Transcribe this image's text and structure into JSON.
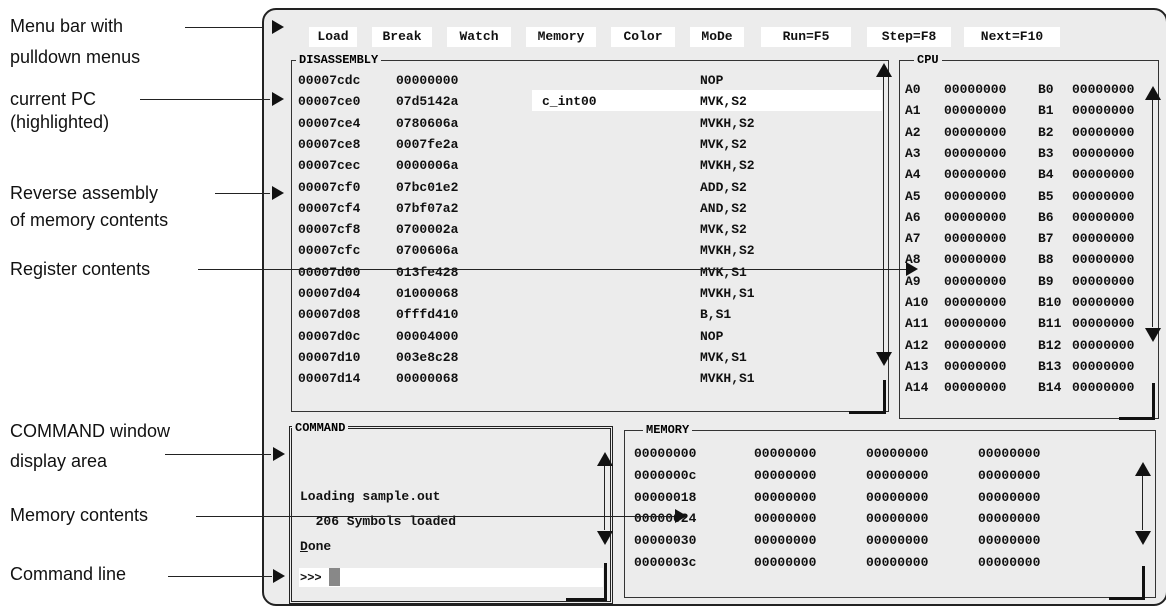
{
  "annotations": {
    "menu_bar_line1": "Menu bar with",
    "menu_bar_line2": "pulldown menus",
    "current_pc_line1": "current PC",
    "current_pc_line2": "(highlighted)",
    "reverse_asm_line1": "Reverse assembly",
    "reverse_asm_line2": "of memory contents",
    "register_contents": "Register contents",
    "command_window_line1": "COMMAND window",
    "command_window_line2": "display area",
    "memory_contents": "Memory contents",
    "command_line": "Command line"
  },
  "menu": [
    "Load",
    "Break",
    "Watch",
    "Memory",
    "Color",
    "MoDe",
    "Run=F5",
    "Step=F8",
    "Next=F10"
  ],
  "disassembly": {
    "title": "DISASSEMBLY",
    "rows": [
      {
        "addr": "00007cdc",
        "code": "00000000",
        "label": "",
        "instr": "NOP"
      },
      {
        "addr": "00007ce0",
        "code": "07d5142a",
        "label": "c_int00",
        "instr": "MVK,S2"
      },
      {
        "addr": "00007ce4",
        "code": "0780606a",
        "label": "",
        "instr": "MVKH,S2"
      },
      {
        "addr": "00007ce8",
        "code": "0007fe2a",
        "label": "",
        "instr": "MVK,S2"
      },
      {
        "addr": "00007cec",
        "code": "0000006a",
        "label": "",
        "instr": "MVKH,S2"
      },
      {
        "addr": "00007cf0",
        "code": "07bc01e2",
        "label": "",
        "instr": "ADD,S2"
      },
      {
        "addr": "00007cf4",
        "code": "07bf07a2",
        "label": "",
        "instr": "AND,S2"
      },
      {
        "addr": "00007cf8",
        "code": "0700002a",
        "label": "",
        "instr": "MVK,S2"
      },
      {
        "addr": "00007cfc",
        "code": "0700606a",
        "label": "",
        "instr": "MVKH,S2"
      },
      {
        "addr": "00007d00",
        "code": "013fe428",
        "label": "",
        "instr": "MVK,S1"
      },
      {
        "addr": "00007d04",
        "code": "01000068",
        "label": "",
        "instr": "MVKH,S1"
      },
      {
        "addr": "00007d08",
        "code": "0fffd410",
        "label": "",
        "instr": "B,S1"
      },
      {
        "addr": "00007d0c",
        "code": "00004000",
        "label": "",
        "instr": "NOP"
      },
      {
        "addr": "00007d10",
        "code": "003e8c28",
        "label": "",
        "instr": "MVK,S1"
      },
      {
        "addr": "00007d14",
        "code": "00000068",
        "label": "",
        "instr": "MVKH,S1"
      }
    ]
  },
  "cpu": {
    "title": "CPU",
    "rows": [
      {
        "a": "A0",
        "av": "00000000",
        "b": "B0",
        "bv": "00000000"
      },
      {
        "a": "A1",
        "av": "00000000",
        "b": "B1",
        "bv": "00000000"
      },
      {
        "a": "A2",
        "av": "00000000",
        "b": "B2",
        "bv": "00000000"
      },
      {
        "a": "A3",
        "av": "00000000",
        "b": "B3",
        "bv": "00000000"
      },
      {
        "a": "A4",
        "av": "00000000",
        "b": "B4",
        "bv": "00000000"
      },
      {
        "a": "A5",
        "av": "00000000",
        "b": "B5",
        "bv": "00000000"
      },
      {
        "a": "A6",
        "av": "00000000",
        "b": "B6",
        "bv": "00000000"
      },
      {
        "a": "A7",
        "av": "00000000",
        "b": "B7",
        "bv": "00000000"
      },
      {
        "a": "A8",
        "av": "00000000",
        "b": "B8",
        "bv": "00000000"
      },
      {
        "a": "A9",
        "av": "00000000",
        "b": "B9",
        "bv": "00000000"
      },
      {
        "a": "A10",
        "av": "00000000",
        "b": "B10",
        "bv": "00000000"
      },
      {
        "a": "A11",
        "av": "00000000",
        "b": "B11",
        "bv": "00000000"
      },
      {
        "a": "A12",
        "av": "00000000",
        "b": "B12",
        "bv": "00000000"
      },
      {
        "a": "A13",
        "av": "00000000",
        "b": "B13",
        "bv": "00000000"
      },
      {
        "a": "A14",
        "av": "00000000",
        "b": "B14",
        "bv": "00000000"
      }
    ]
  },
  "command": {
    "title": "COMMAND",
    "lines": [
      "Loading sample.out",
      "  206 Symbols loaded",
      "Done"
    ],
    "prompt": ">>>"
  },
  "memory": {
    "title": "MEMORY",
    "rows": [
      [
        "00000000",
        "00000000",
        "00000000",
        "00000000"
      ],
      [
        "0000000c",
        "00000000",
        "00000000",
        "00000000"
      ],
      [
        "00000018",
        "00000000",
        "00000000",
        "00000000"
      ],
      [
        "00000024",
        "00000000",
        "00000000",
        "00000000"
      ],
      [
        "00000030",
        "00000000",
        "00000000",
        "00000000"
      ],
      [
        "0000003c",
        "00000000",
        "00000000",
        "00000000"
      ]
    ]
  }
}
